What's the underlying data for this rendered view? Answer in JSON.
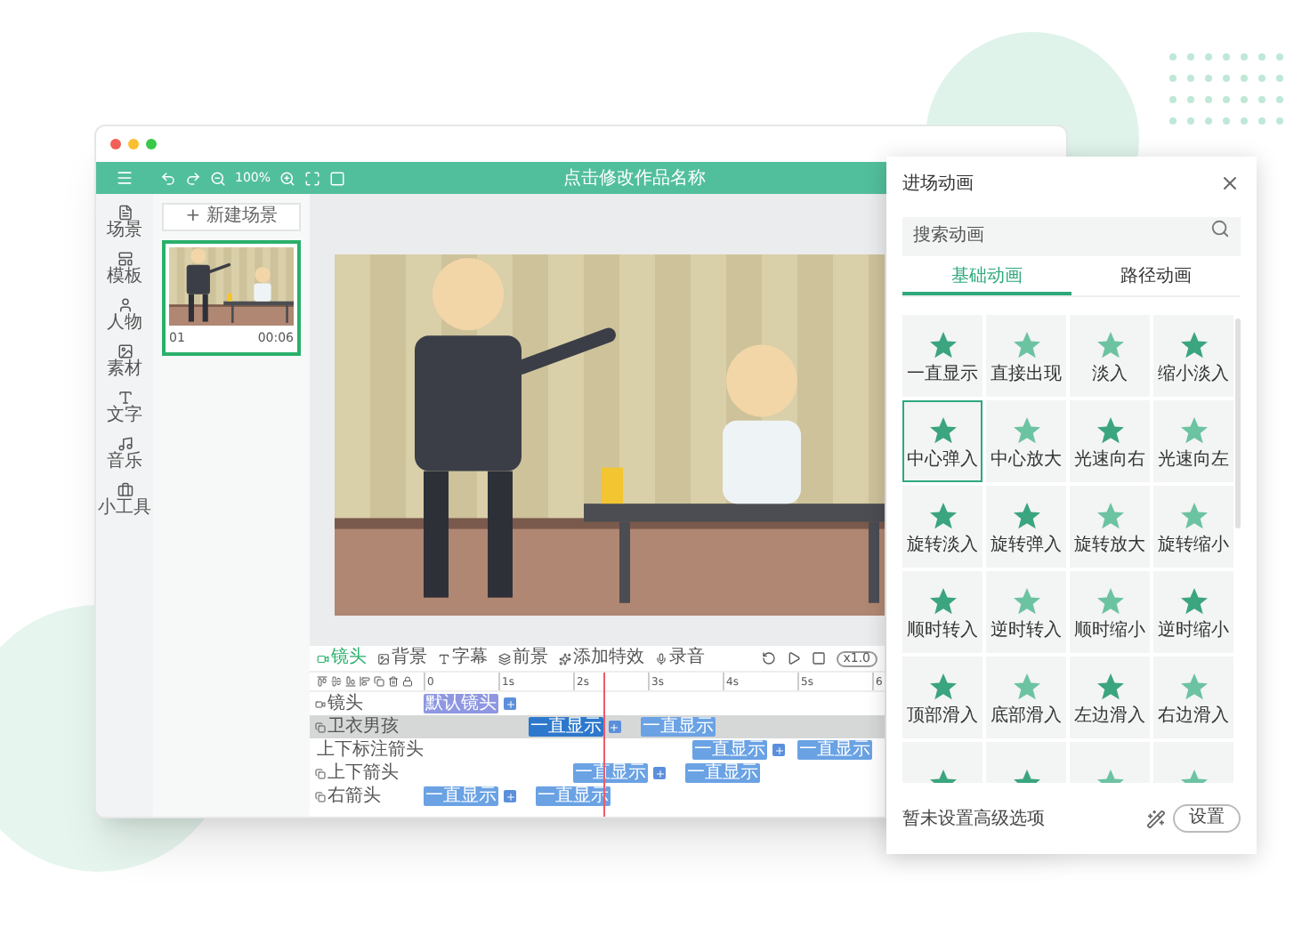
{
  "toolbar": {
    "zoom": "100%",
    "title": "点击修改作品名称"
  },
  "sidebar": {
    "items": [
      {
        "label": "场景"
      },
      {
        "label": "模板"
      },
      {
        "label": "人物"
      },
      {
        "label": "素材"
      },
      {
        "label": "文字"
      },
      {
        "label": "音乐"
      },
      {
        "label": "小工具"
      }
    ]
  },
  "scenes": {
    "new_button": "+ 新建场景",
    "items": [
      {
        "number": "01",
        "duration": "00:06",
        "selected": true
      }
    ]
  },
  "timeline": {
    "tools": [
      "镜头",
      "背景",
      "字幕",
      "前景",
      "添加特效",
      "录音"
    ],
    "speed": "x1.0",
    "ruler": [
      "0",
      "1s",
      "2s",
      "3s",
      "4s",
      "5s",
      "6"
    ],
    "rows": [
      {
        "name": "镜头",
        "kind": "camera",
        "selected": false,
        "clips": [
          {
            "label": "默认镜头",
            "selected": false
          }
        ]
      },
      {
        "name": "卫衣男孩",
        "kind": "element",
        "selected": true,
        "clips": [
          {
            "label": "一直显示",
            "selected": true
          },
          {
            "label": "一直显示",
            "selected": false
          }
        ]
      },
      {
        "name": "上下标注箭头",
        "kind": "element",
        "selected": false,
        "clips": [
          {
            "label": "一直显示",
            "selected": false
          },
          {
            "label": "一直显示",
            "selected": false
          }
        ]
      },
      {
        "name": "上下箭头",
        "kind": "element",
        "selected": false,
        "clips": [
          {
            "label": "一直显示",
            "selected": false
          },
          {
            "label": "一直显示",
            "selected": false
          }
        ]
      },
      {
        "name": "右箭头",
        "kind": "element",
        "selected": false,
        "clips": [
          {
            "label": "一直显示",
            "selected": false
          },
          {
            "label": "一直显示",
            "selected": false
          }
        ]
      }
    ]
  },
  "panel": {
    "title": "进场动画",
    "search": {
      "placeholder": "搜索动画"
    },
    "tabs": [
      {
        "label": "基础动画",
        "selected": true
      },
      {
        "label": "路径动画",
        "selected": false
      }
    ],
    "animations": [
      {
        "label": "一直显示",
        "selected": false
      },
      {
        "label": "直接出现",
        "selected": false
      },
      {
        "label": "淡入",
        "selected": false
      },
      {
        "label": "缩小淡入",
        "selected": false
      },
      {
        "label": "中心弹入",
        "selected": true
      },
      {
        "label": "中心放大",
        "selected": false
      },
      {
        "label": "光速向右",
        "selected": false
      },
      {
        "label": "光速向左",
        "selected": false
      },
      {
        "label": "旋转淡入",
        "selected": false
      },
      {
        "label": "旋转弹入",
        "selected": false
      },
      {
        "label": "旋转放大",
        "selected": false
      },
      {
        "label": "旋转缩小",
        "selected": false
      },
      {
        "label": "顺时转入",
        "selected": false
      },
      {
        "label": "逆时转入",
        "selected": false
      },
      {
        "label": "顺时缩小",
        "selected": false
      },
      {
        "label": "逆时缩小",
        "selected": false
      },
      {
        "label": "顶部滑入",
        "selected": false
      },
      {
        "label": "底部滑入",
        "selected": false
      },
      {
        "label": "左边滑入",
        "selected": false
      },
      {
        "label": "右边滑入",
        "selected": false
      },
      {
        "selected": false
      },
      {
        "selected": false
      },
      {
        "selected": false
      },
      {
        "selected": false
      }
    ],
    "footer": {
      "text": "暂未设置高级选项",
      "button": "设置"
    }
  }
}
